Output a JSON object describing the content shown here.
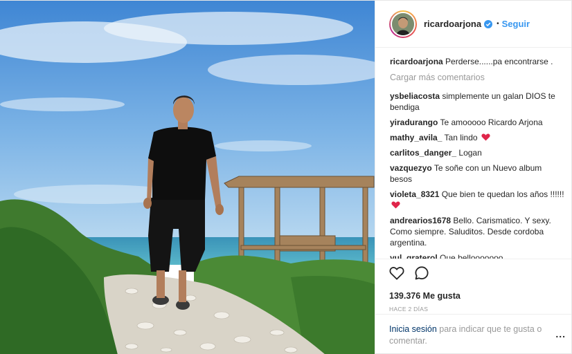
{
  "header": {
    "username": "ricardoarjona",
    "verified_icon": "verified-badge-icon",
    "separator": "•",
    "follow_label": "Seguir"
  },
  "caption": {
    "username": "ricardoarjona",
    "text": "Perderse......pa encontrarse ."
  },
  "load_more_label": "Cargar más comentarios",
  "comments": [
    {
      "username": "ysbeliacosta",
      "text": "simplemente un galan DIOS te bendiga"
    },
    {
      "username": "yiradurango",
      "text": "Te amooooo Ricardo Arjona"
    },
    {
      "username": "mathy_avila_",
      "text": "Tan lindo",
      "emoji": "red-heart-icon"
    },
    {
      "username": "carlitos_danger_",
      "text": "Logan"
    },
    {
      "username": "vazquezyo",
      "text": "Te soñe con un Nuevo album besos"
    },
    {
      "username": "violeta_8321",
      "text": "Que bien te quedan los años !!!!!!",
      "emoji": "red-heart-icon"
    },
    {
      "username": "andrearios1678",
      "text": "Bello. Carismatico. Y sexy. Como siempre. Saluditos. Desde cordoba argentina."
    },
    {
      "username": "yul_graterol",
      "text": "Que bellooooooo"
    }
  ],
  "actions": {
    "like_icon": "heart-outline-icon",
    "comment_icon": "comment-bubble-icon",
    "likes_text": "139.376 Me gusta",
    "date_text": "HACE 2 DÍAS"
  },
  "login_prompt": {
    "link_text": "Inicia sesión",
    "rest_text": " para indicar que te gusta o comentar."
  },
  "more_options_label": "...",
  "colors": {
    "link_blue": "#3897f0",
    "login_link": "#003569",
    "muted": "#999999",
    "text": "#262626"
  }
}
